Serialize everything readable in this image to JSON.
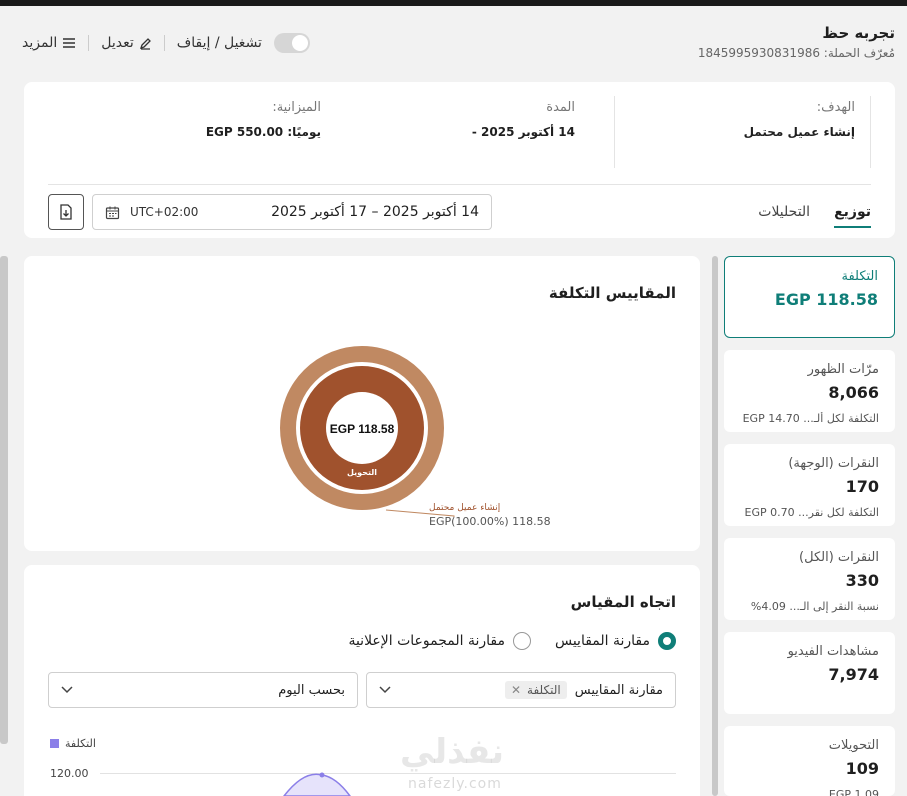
{
  "header": {
    "title": "تجربه حظ",
    "campaign_id_label": "مُعرّف الحملة: 1845995930831986",
    "toggle_label": "تشغيل / إيقاف",
    "edit_label": "تعديل",
    "more_label": "المزيد"
  },
  "info": {
    "goal_label": "الهدف:",
    "goal_value": "إنشاء عميل محتمل",
    "duration_label": "المدة",
    "duration_value": "14 أكتوبر 2025 -",
    "budget_label": "الميزانية:",
    "budget_value": "يوميًا: EGP 550.00"
  },
  "tabs": [
    "توزيع",
    "التحليلات"
  ],
  "date_range": {
    "timezone": "UTC+02:00",
    "range": "14 أكتوبر 2025 – 17 أكتوبر 2025"
  },
  "cost_metrics": {
    "title": "المقاييس التكلفة",
    "center_value": "EGP 118.58",
    "inner_label": "التحويل",
    "callout_name": "إنشاء عميل محتمل",
    "callout_value": "EGP(100.00%) 118.58"
  },
  "trend": {
    "title": "اتجاه المقياس",
    "radio_compare_metrics": "مقارنة المقاييس",
    "radio_compare_adsets": "مقارنة المجموعات الإعلانية",
    "select_metrics_label": "مقارنة المقاييس",
    "select_metrics_chip": "التكلفة",
    "select_period": "بحسب اليوم",
    "legend_label": "التكلفة",
    "y_tick_top": "120.00"
  },
  "metrics": [
    {
      "label": "التكلفة",
      "value": "EGP 118.58",
      "sub": ""
    },
    {
      "label": "مرّات الظهور",
      "value": "8,066",
      "sub": "التكلفة لكل ألـ...  EGP 14.70"
    },
    {
      "label": "النقرات (الوجهة)",
      "value": "170",
      "sub": "التكلفة لكل نقر...  EGP 0.70"
    },
    {
      "label": "النقرات (الكل)",
      "value": "330",
      "sub": "نسبة النقر إلى الـ...   4.09%"
    },
    {
      "label": "مشاهدات الفيديو",
      "value": "7,974",
      "sub": ""
    },
    {
      "label": "التحويلات",
      "value": "109",
      "sub": "EGP 1.09"
    }
  ],
  "watermark": {
    "ar": "نفذلي",
    "en": "nafezly.com"
  },
  "colors": {
    "accent": "#0f7e78",
    "donut_outer": "#c08962",
    "donut_inner": "#a0522d",
    "series": "#8b7fe8"
  }
}
